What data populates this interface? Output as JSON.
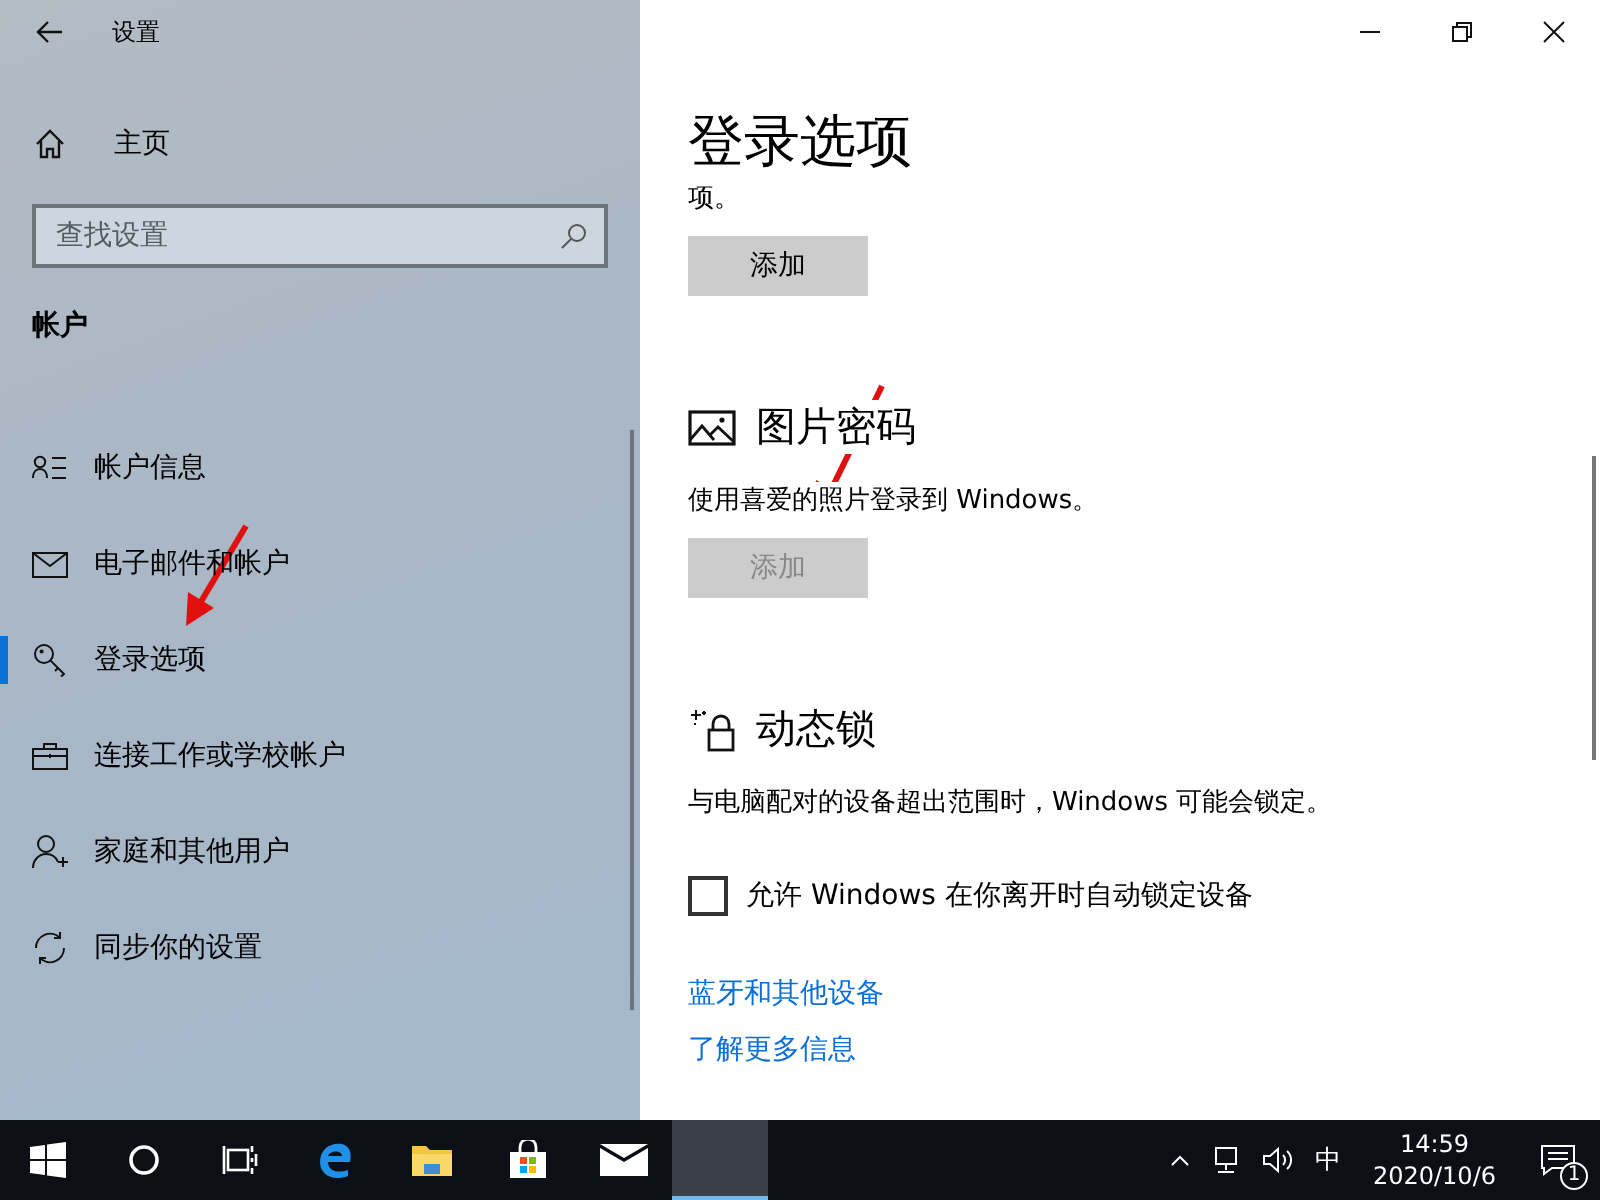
{
  "window": {
    "title": "设置"
  },
  "sidebar": {
    "home": "主页",
    "search": {
      "placeholder": "查找设置"
    },
    "section": "帐户",
    "items": [
      {
        "label": "帐户信息",
        "selected": false
      },
      {
        "label": "电子邮件和帐户",
        "selected": false
      },
      {
        "label": "登录选项",
        "selected": true
      },
      {
        "label": "连接工作或学校帐户",
        "selected": false
      },
      {
        "label": "家庭和其他用户",
        "selected": false
      },
      {
        "label": "同步你的设置",
        "selected": false
      }
    ]
  },
  "content": {
    "title": "登录选项",
    "sections": [
      {
        "kind": "tail",
        "text": "项。",
        "button": {
          "label": "添加",
          "disabled": false
        }
      },
      {
        "kind": "picture-password",
        "heading": "图片密码",
        "description": "使用喜爱的照片登录到 Windows。",
        "button": {
          "label": "添加",
          "disabled": true
        }
      },
      {
        "kind": "dynamic-lock",
        "heading": "动态锁",
        "description": "与电脑配对的设备超出范围时，Windows 可能会锁定。",
        "checkbox": {
          "label": "允许 Windows 在你离开时自动锁定设备",
          "checked": false
        }
      }
    ],
    "links": [
      "蓝牙和其他设备",
      "了解更多信息"
    ]
  },
  "taskbar": {
    "apps": [
      {
        "selected": false
      },
      {
        "selected": false
      },
      {
        "selected": false
      },
      {
        "selected": false
      },
      {
        "selected": false
      },
      {
        "selected": false
      },
      {
        "selected": false
      },
      {
        "selected": true
      }
    ],
    "ime": "中",
    "time": "14:59",
    "date": "2020/10/6",
    "notifications": "1"
  }
}
